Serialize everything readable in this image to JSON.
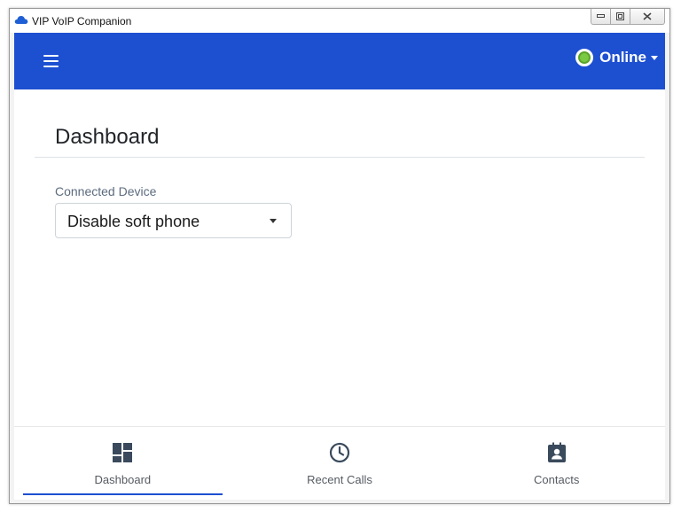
{
  "window": {
    "title": "VIP VoIP Companion",
    "controls": [
      "minimize",
      "restore",
      "close"
    ]
  },
  "header": {
    "menu_icon": "hamburger-menu-icon",
    "status": {
      "label": "Online",
      "color": "#7ac943"
    },
    "background": "#1d4fd1"
  },
  "main": {
    "title": "Dashboard",
    "connected_device": {
      "label": "Connected Device",
      "selected": "Disable soft phone"
    }
  },
  "bottom_nav": {
    "items": [
      {
        "label": "Dashboard",
        "icon": "dashboard-icon",
        "active": true
      },
      {
        "label": "Recent Calls",
        "icon": "clock-icon",
        "active": false
      },
      {
        "label": "Contacts",
        "icon": "contacts-icon",
        "active": false
      }
    ],
    "active_color": "#1d4fd1",
    "icon_color": "#3a4a5c"
  }
}
